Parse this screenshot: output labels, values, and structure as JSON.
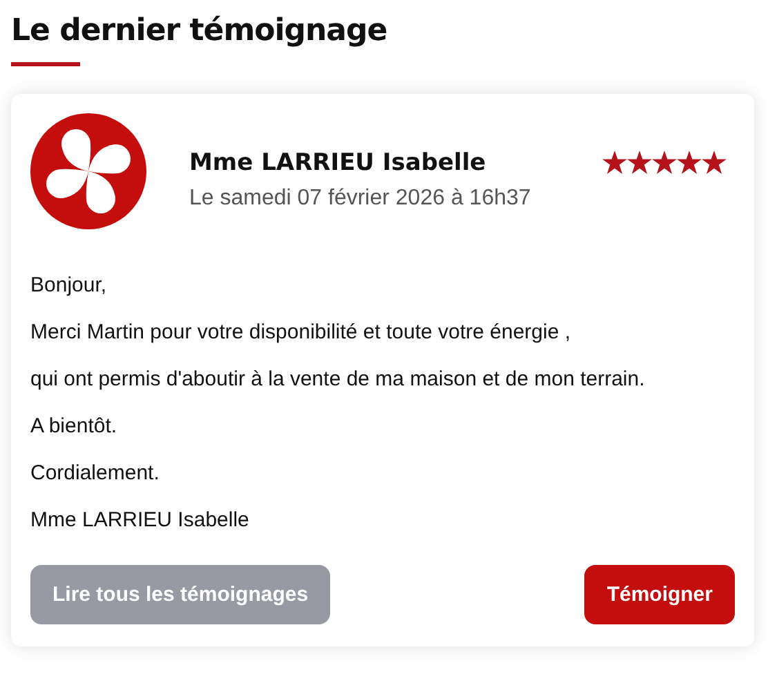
{
  "heading": "Le dernier témoignage",
  "testimonial": {
    "author": "Mme LARRIEU Isabelle",
    "date": "Le samedi 07 février 2026 à 16h37",
    "stars": 5,
    "paragraphs": [
      "Bonjour,",
      "Merci Martin pour votre disponibilité et toute votre énergie ,",
      "qui ont permis d'aboutir à la vente de ma maison et de mon terrain.",
      "A bientôt.",
      "Cordialement.",
      "Mme LARRIEU Isabelle"
    ]
  },
  "buttons": [
    {
      "label": "Lire tous les témoignages",
      "kind": "secondary"
    },
    {
      "label": "Témoigner",
      "kind": "primary"
    }
  ]
}
